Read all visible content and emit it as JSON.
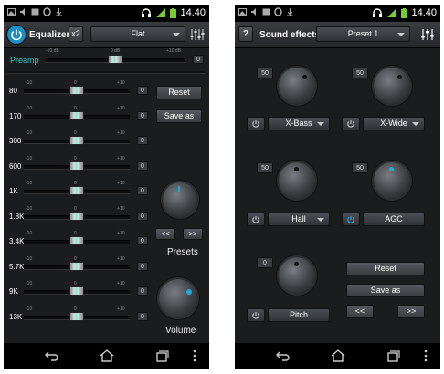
{
  "status": {
    "time": "14.40"
  },
  "eq": {
    "title": "Equalizer",
    "x2": "x2",
    "preset": "Flat",
    "preamp_label": "Preamp",
    "preamp_scale": [
      "-10 dB",
      "0 dB",
      "+10 dB"
    ],
    "preamp_value": "0",
    "band_scale": [
      "-10",
      "0",
      "+10"
    ],
    "bands": [
      {
        "label": "80",
        "value": "0"
      },
      {
        "label": "170",
        "value": "0"
      },
      {
        "label": "300",
        "value": "0"
      },
      {
        "label": "600",
        "value": "0"
      },
      {
        "label": "1K",
        "value": "0"
      },
      {
        "label": "1.8K",
        "value": "0"
      },
      {
        "label": "3.4K",
        "value": "0"
      },
      {
        "label": "5.7K",
        "value": "0"
      },
      {
        "label": "9K",
        "value": "0"
      },
      {
        "label": "13K",
        "value": "0"
      }
    ],
    "reset": "Reset",
    "save_as": "Save as",
    "prev": "<<",
    "next": ">>",
    "presets_label": "Presets",
    "volume_label": "Volume"
  },
  "sfx": {
    "help": "?",
    "title": "Sound effects",
    "preset": "Preset 1",
    "xbass": {
      "level": "50",
      "label": "X-Bass"
    },
    "xwide": {
      "level": "50",
      "label": "X-Wide"
    },
    "hall": {
      "level": "50",
      "label": "Hall"
    },
    "agc": {
      "level": "50",
      "label": "AGC"
    },
    "pitch": {
      "level": "0",
      "label": "Pitch"
    },
    "reset": "Reset",
    "save_as": "Save as",
    "prev": "<<",
    "next": ">>"
  },
  "colors": {
    "accent": "#22aadd",
    "preamp": "#33c4c4"
  }
}
